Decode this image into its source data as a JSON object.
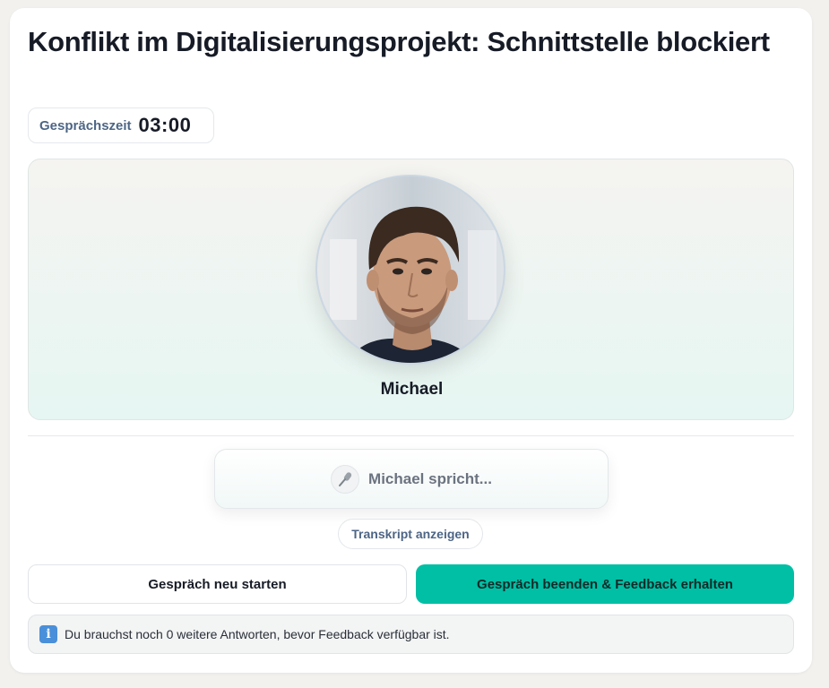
{
  "scenario": {
    "title": "Konflikt im Digitalisierungsprojekt: Schnittstelle blockiert"
  },
  "timer": {
    "label": "Gesprächszeit",
    "value": "03:00"
  },
  "persona": {
    "name": "Michael"
  },
  "status": {
    "icon": "microphone-icon",
    "text": "Michael spricht..."
  },
  "actions": {
    "transcript_label": "Transkript anzeigen",
    "restart_label": "Gespräch neu starten",
    "end_label": "Gespräch beenden & Feedback erhalten"
  },
  "notice": {
    "icon": "info-icon",
    "text": "Du brauchst noch 0 weitere Antworten, bevor Feedback verfügbar ist."
  },
  "colors": {
    "accent": "#00bfa5",
    "muted_label": "#4d6585",
    "background": "#f2f1ee"
  }
}
